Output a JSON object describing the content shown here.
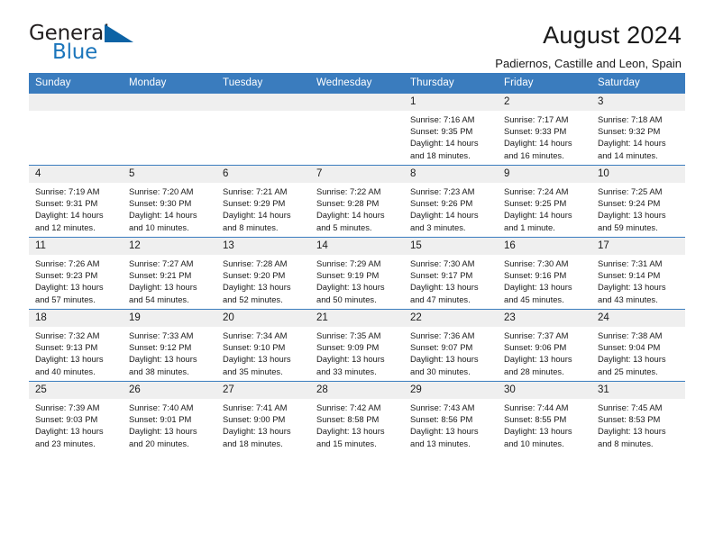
{
  "brand": {
    "name_part1": "General",
    "name_part2": "Blue",
    "logo_icon": "triangle-logo-icon"
  },
  "header": {
    "title": "August 2024",
    "subtitle": "Padiernos, Castille and Leon, Spain"
  },
  "calendar": {
    "weekday_headers": [
      "Sunday",
      "Monday",
      "Tuesday",
      "Wednesday",
      "Thursday",
      "Friday",
      "Saturday"
    ],
    "accent_color": "#3a7cbe",
    "daynum_bg": "#efefef",
    "weeks": [
      [
        {
          "day": "",
          "sunrise": "",
          "sunset": "",
          "daylight_line1": "",
          "daylight_line2": ""
        },
        {
          "day": "",
          "sunrise": "",
          "sunset": "",
          "daylight_line1": "",
          "daylight_line2": ""
        },
        {
          "day": "",
          "sunrise": "",
          "sunset": "",
          "daylight_line1": "",
          "daylight_line2": ""
        },
        {
          "day": "",
          "sunrise": "",
          "sunset": "",
          "daylight_line1": "",
          "daylight_line2": ""
        },
        {
          "day": "1",
          "sunrise": "Sunrise: 7:16 AM",
          "sunset": "Sunset: 9:35 PM",
          "daylight_line1": "Daylight: 14 hours",
          "daylight_line2": "and 18 minutes."
        },
        {
          "day": "2",
          "sunrise": "Sunrise: 7:17 AM",
          "sunset": "Sunset: 9:33 PM",
          "daylight_line1": "Daylight: 14 hours",
          "daylight_line2": "and 16 minutes."
        },
        {
          "day": "3",
          "sunrise": "Sunrise: 7:18 AM",
          "sunset": "Sunset: 9:32 PM",
          "daylight_line1": "Daylight: 14 hours",
          "daylight_line2": "and 14 minutes."
        }
      ],
      [
        {
          "day": "4",
          "sunrise": "Sunrise: 7:19 AM",
          "sunset": "Sunset: 9:31 PM",
          "daylight_line1": "Daylight: 14 hours",
          "daylight_line2": "and 12 minutes."
        },
        {
          "day": "5",
          "sunrise": "Sunrise: 7:20 AM",
          "sunset": "Sunset: 9:30 PM",
          "daylight_line1": "Daylight: 14 hours",
          "daylight_line2": "and 10 minutes."
        },
        {
          "day": "6",
          "sunrise": "Sunrise: 7:21 AM",
          "sunset": "Sunset: 9:29 PM",
          "daylight_line1": "Daylight: 14 hours",
          "daylight_line2": "and 8 minutes."
        },
        {
          "day": "7",
          "sunrise": "Sunrise: 7:22 AM",
          "sunset": "Sunset: 9:28 PM",
          "daylight_line1": "Daylight: 14 hours",
          "daylight_line2": "and 5 minutes."
        },
        {
          "day": "8",
          "sunrise": "Sunrise: 7:23 AM",
          "sunset": "Sunset: 9:26 PM",
          "daylight_line1": "Daylight: 14 hours",
          "daylight_line2": "and 3 minutes."
        },
        {
          "day": "9",
          "sunrise": "Sunrise: 7:24 AM",
          "sunset": "Sunset: 9:25 PM",
          "daylight_line1": "Daylight: 14 hours",
          "daylight_line2": "and 1 minute."
        },
        {
          "day": "10",
          "sunrise": "Sunrise: 7:25 AM",
          "sunset": "Sunset: 9:24 PM",
          "daylight_line1": "Daylight: 13 hours",
          "daylight_line2": "and 59 minutes."
        }
      ],
      [
        {
          "day": "11",
          "sunrise": "Sunrise: 7:26 AM",
          "sunset": "Sunset: 9:23 PM",
          "daylight_line1": "Daylight: 13 hours",
          "daylight_line2": "and 57 minutes."
        },
        {
          "day": "12",
          "sunrise": "Sunrise: 7:27 AM",
          "sunset": "Sunset: 9:21 PM",
          "daylight_line1": "Daylight: 13 hours",
          "daylight_line2": "and 54 minutes."
        },
        {
          "day": "13",
          "sunrise": "Sunrise: 7:28 AM",
          "sunset": "Sunset: 9:20 PM",
          "daylight_line1": "Daylight: 13 hours",
          "daylight_line2": "and 52 minutes."
        },
        {
          "day": "14",
          "sunrise": "Sunrise: 7:29 AM",
          "sunset": "Sunset: 9:19 PM",
          "daylight_line1": "Daylight: 13 hours",
          "daylight_line2": "and 50 minutes."
        },
        {
          "day": "15",
          "sunrise": "Sunrise: 7:30 AM",
          "sunset": "Sunset: 9:17 PM",
          "daylight_line1": "Daylight: 13 hours",
          "daylight_line2": "and 47 minutes."
        },
        {
          "day": "16",
          "sunrise": "Sunrise: 7:30 AM",
          "sunset": "Sunset: 9:16 PM",
          "daylight_line1": "Daylight: 13 hours",
          "daylight_line2": "and 45 minutes."
        },
        {
          "day": "17",
          "sunrise": "Sunrise: 7:31 AM",
          "sunset": "Sunset: 9:14 PM",
          "daylight_line1": "Daylight: 13 hours",
          "daylight_line2": "and 43 minutes."
        }
      ],
      [
        {
          "day": "18",
          "sunrise": "Sunrise: 7:32 AM",
          "sunset": "Sunset: 9:13 PM",
          "daylight_line1": "Daylight: 13 hours",
          "daylight_line2": "and 40 minutes."
        },
        {
          "day": "19",
          "sunrise": "Sunrise: 7:33 AM",
          "sunset": "Sunset: 9:12 PM",
          "daylight_line1": "Daylight: 13 hours",
          "daylight_line2": "and 38 minutes."
        },
        {
          "day": "20",
          "sunrise": "Sunrise: 7:34 AM",
          "sunset": "Sunset: 9:10 PM",
          "daylight_line1": "Daylight: 13 hours",
          "daylight_line2": "and 35 minutes."
        },
        {
          "day": "21",
          "sunrise": "Sunrise: 7:35 AM",
          "sunset": "Sunset: 9:09 PM",
          "daylight_line1": "Daylight: 13 hours",
          "daylight_line2": "and 33 minutes."
        },
        {
          "day": "22",
          "sunrise": "Sunrise: 7:36 AM",
          "sunset": "Sunset: 9:07 PM",
          "daylight_line1": "Daylight: 13 hours",
          "daylight_line2": "and 30 minutes."
        },
        {
          "day": "23",
          "sunrise": "Sunrise: 7:37 AM",
          "sunset": "Sunset: 9:06 PM",
          "daylight_line1": "Daylight: 13 hours",
          "daylight_line2": "and 28 minutes."
        },
        {
          "day": "24",
          "sunrise": "Sunrise: 7:38 AM",
          "sunset": "Sunset: 9:04 PM",
          "daylight_line1": "Daylight: 13 hours",
          "daylight_line2": "and 25 minutes."
        }
      ],
      [
        {
          "day": "25",
          "sunrise": "Sunrise: 7:39 AM",
          "sunset": "Sunset: 9:03 PM",
          "daylight_line1": "Daylight: 13 hours",
          "daylight_line2": "and 23 minutes."
        },
        {
          "day": "26",
          "sunrise": "Sunrise: 7:40 AM",
          "sunset": "Sunset: 9:01 PM",
          "daylight_line1": "Daylight: 13 hours",
          "daylight_line2": "and 20 minutes."
        },
        {
          "day": "27",
          "sunrise": "Sunrise: 7:41 AM",
          "sunset": "Sunset: 9:00 PM",
          "daylight_line1": "Daylight: 13 hours",
          "daylight_line2": "and 18 minutes."
        },
        {
          "day": "28",
          "sunrise": "Sunrise: 7:42 AM",
          "sunset": "Sunset: 8:58 PM",
          "daylight_line1": "Daylight: 13 hours",
          "daylight_line2": "and 15 minutes."
        },
        {
          "day": "29",
          "sunrise": "Sunrise: 7:43 AM",
          "sunset": "Sunset: 8:56 PM",
          "daylight_line1": "Daylight: 13 hours",
          "daylight_line2": "and 13 minutes."
        },
        {
          "day": "30",
          "sunrise": "Sunrise: 7:44 AM",
          "sunset": "Sunset: 8:55 PM",
          "daylight_line1": "Daylight: 13 hours",
          "daylight_line2": "and 10 minutes."
        },
        {
          "day": "31",
          "sunrise": "Sunrise: 7:45 AM",
          "sunset": "Sunset: 8:53 PM",
          "daylight_line1": "Daylight: 13 hours",
          "daylight_line2": "and 8 minutes."
        }
      ]
    ]
  }
}
